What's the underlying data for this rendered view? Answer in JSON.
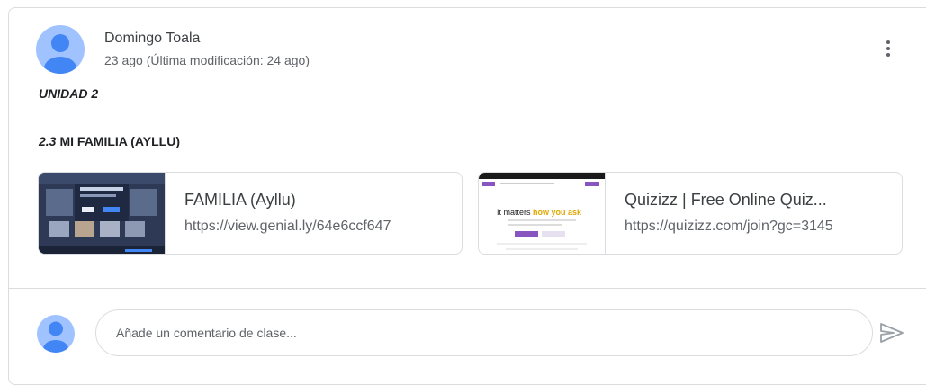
{
  "post": {
    "author": "Domingo Toala",
    "meta": "23 ago (Última modificación: 24 ago)",
    "unit": "UNIDAD 2",
    "section_number": "2.3",
    "section_title": "MI FAMILIA (AYLLU)"
  },
  "attachments": [
    {
      "title": "FAMILIA (Ayllu)",
      "url": "https://view.genial.ly/64e6ccf647"
    },
    {
      "title": "Quizizz | Free Online Quiz...",
      "url": "https://quizizz.com/join?gc=3145",
      "thumb_text_1": "It matters ",
      "thumb_text_2": "how you ask"
    }
  ],
  "comment": {
    "placeholder": "Añade un comentario de clase..."
  },
  "colors": {
    "avatar_bg": "#a0c3ff",
    "avatar_fg": "#4285f4",
    "border": "#dadce0",
    "text": "#3c4043",
    "secondary": "#5f6368",
    "quizizz_purple": "#8854c0",
    "quizizz_highlight": "#f5b800"
  },
  "icons": [
    "avatar-icon",
    "more-vert-icon",
    "send-icon"
  ]
}
